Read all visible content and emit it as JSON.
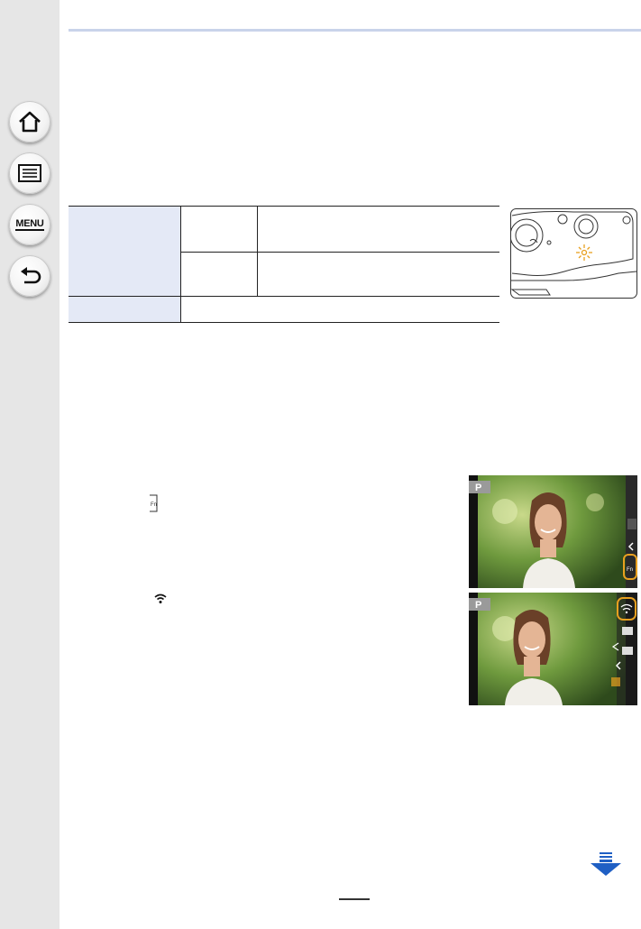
{
  "sidebar": {
    "home": "home-icon",
    "contents": "list-icon",
    "menu_label": "MENU",
    "back": "back-arrow-icon"
  },
  "page": {
    "page_number": ""
  },
  "colors": {
    "sidebar_bg": "#e6e6e6",
    "header_rule": "#c9d3ea",
    "table_header_bg": "#e4e9f6",
    "highlight_ring": "#e8a020",
    "next_arrow": "#1f5fc4"
  }
}
